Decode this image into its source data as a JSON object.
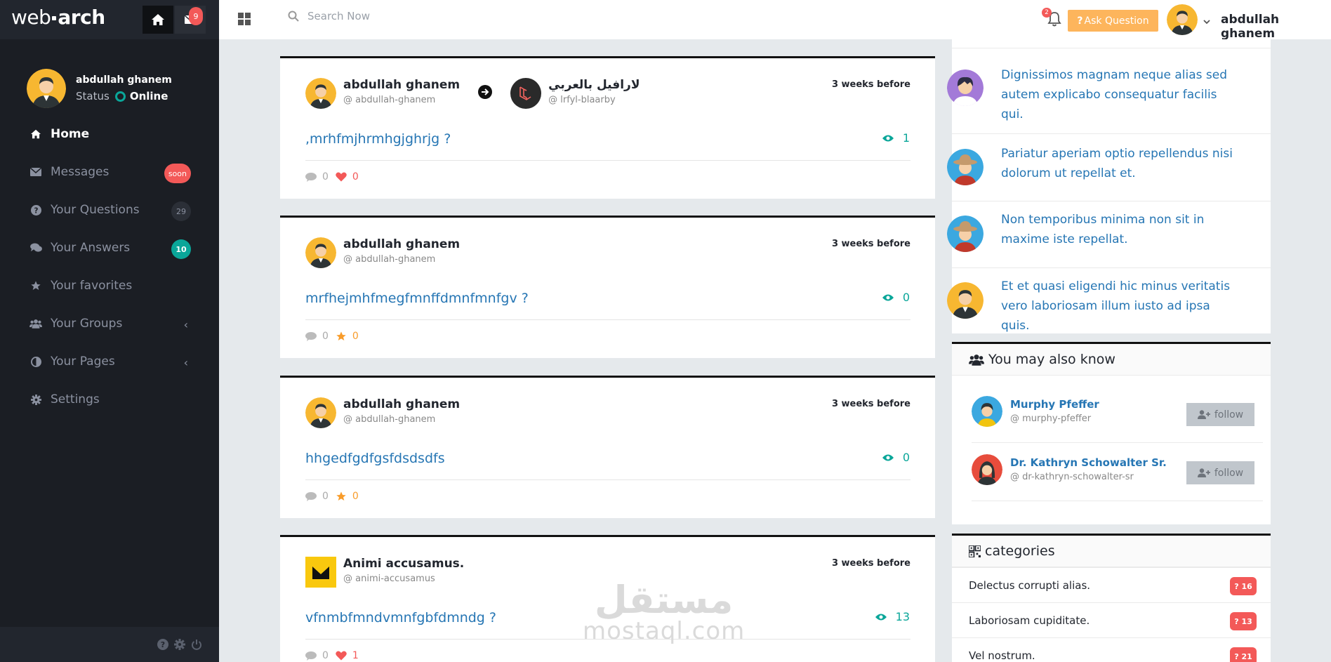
{
  "brand": {
    "name_light": "web",
    "name_bold": "arch"
  },
  "top_nav": {
    "mail_badge": "9"
  },
  "profile": {
    "name": "abdullah ghanem",
    "status_label": "Status",
    "status_value": "Online"
  },
  "sidebar": {
    "items": [
      {
        "label": "Home",
        "icon": "home-icon",
        "active": true
      },
      {
        "label": "Messages",
        "icon": "envelope-icon",
        "badge": "soon"
      },
      {
        "label": "Your Questions",
        "icon": "question-circle-icon",
        "badge": "29"
      },
      {
        "label": "Your Answers",
        "icon": "comments-icon",
        "badge": "10"
      },
      {
        "label": "Your favorites",
        "icon": "star-icon"
      },
      {
        "label": "Your Groups",
        "icon": "users-icon",
        "chevron": "‹"
      },
      {
        "label": "Your Pages",
        "icon": "adjust-icon",
        "chevron": "‹"
      },
      {
        "label": "Settings",
        "icon": "gear-icon"
      }
    ]
  },
  "header": {
    "search_placeholder": "Search Now",
    "notifications_badge": "2",
    "ask_button": "Ask Question",
    "user_name": "abdullah ghanem"
  },
  "questions": [
    {
      "author": "abdullah ghanem",
      "author_handle": "@ abdullah-ghanem",
      "page": "لارافيل بالعربي",
      "page_handle": "@ lrfyl-blaarby",
      "time": "3 weeks before",
      "title": ",mrhfmjhrmhgjghrjg ?",
      "views": "1",
      "comments": "0",
      "reaction": "heart",
      "reaction_count": "0"
    },
    {
      "author": "abdullah ghanem",
      "author_handle": "@ abdullah-ghanem",
      "time": "3 weeks before",
      "title": "mrfhejmhfmegfmnffdmnfmnfgv ?",
      "views": "0",
      "comments": "0",
      "reaction": "star",
      "reaction_count": "0"
    },
    {
      "author": "abdullah ghanem",
      "author_handle": "@ abdullah-ghanem",
      "time": "3 weeks before",
      "title": "hhgedfgdfgsfdsdsdfs",
      "views": "0",
      "comments": "0",
      "reaction": "star",
      "reaction_count": "0"
    },
    {
      "author": "Animi accusamus.",
      "author_handle": "@ animi-accusamus",
      "time": "3 weeks before",
      "title": "vfnmbfmndvmnfgbfdmndg ?",
      "views": "13",
      "comments": "0",
      "reaction": "heart",
      "reaction_count": "1"
    }
  ],
  "watermark": {
    "arabic": "مستقل",
    "latin": "mostaql.com"
  },
  "activity": [
    {
      "text": "Dignissimos magnam neque alias sed autem explicabo consequatur facilis qui."
    },
    {
      "text": "Pariatur aperiam optio repellendus nisi dolorum ut repellat et."
    },
    {
      "text": "Non temporibus minima non sit in maxime iste repellat."
    },
    {
      "text": "Et et quasi eligendi hic minus veritatis vero laboriosam illum iusto ad ipsa quis."
    }
  ],
  "know": {
    "title": "You may also know",
    "people": [
      {
        "name": "Murphy Pfeffer",
        "handle": "@ murphy-pfeffer",
        "button": "follow"
      },
      {
        "name": "Dr. Kathryn Schowalter Sr.",
        "handle": "@ dr-kathryn-schowalter-sr",
        "button": "follow"
      }
    ]
  },
  "categories": {
    "title": "categories",
    "items": [
      {
        "name": "Delectus corrupti alias.",
        "count": "16"
      },
      {
        "name": "Laboriosam cupiditate.",
        "count": "13"
      },
      {
        "name": "Vel nostrum.",
        "count": "21"
      }
    ]
  },
  "colors": {
    "accent_blue": "#2676b4",
    "teal": "#0aa699",
    "red": "#f35958",
    "orange": "#fdb55c",
    "sidebar": "#1b1e24"
  }
}
